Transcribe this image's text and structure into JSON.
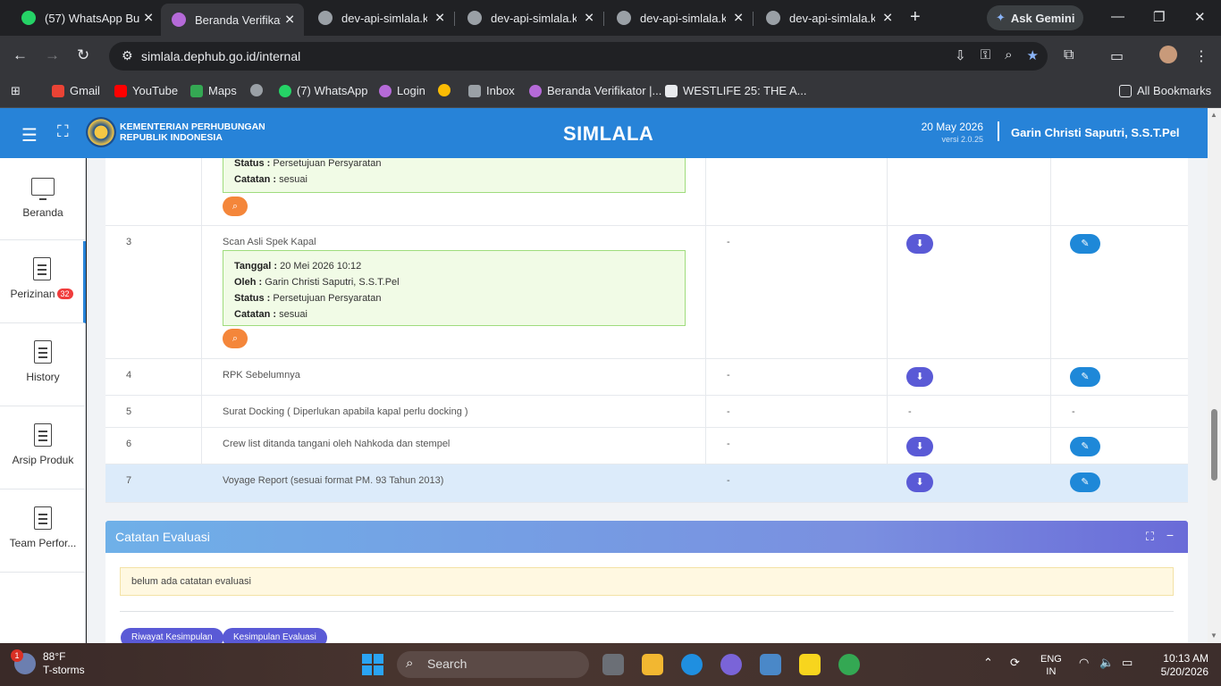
{
  "browser": {
    "tabs": [
      {
        "title": "(57) WhatsApp Bu",
        "favicon_color": "#25d366",
        "active": false
      },
      {
        "title": "Beranda Verifikato",
        "favicon_color": "#b56ad8",
        "active": true
      },
      {
        "title": "dev-api-simlala.ke",
        "favicon_color": "#9aa0a6",
        "active": false
      },
      {
        "title": "dev-api-simlala.ke",
        "favicon_color": "#9aa0a6",
        "active": false
      },
      {
        "title": "dev-api-simlala.ke",
        "favicon_color": "#9aa0a6",
        "active": false
      },
      {
        "title": "dev-api-simlala.ke",
        "favicon_color": "#9aa0a6",
        "active": false
      }
    ],
    "new_tab_symbol": "+",
    "ask_gemini": "Ask Gemini",
    "url": "simlala.dephub.go.id/internal",
    "bookmarks": [
      {
        "label": "Gmail",
        "color": "#ea4335"
      },
      {
        "label": "YouTube",
        "color": "#ff0000"
      },
      {
        "label": "Maps",
        "color": "#34a853"
      },
      {
        "label": "",
        "color": "#9aa0a6"
      },
      {
        "label": "(7) WhatsApp",
        "color": "#25d366"
      },
      {
        "label": "Login",
        "color": "#b56ad8"
      },
      {
        "label": "",
        "color": "#fbbc04"
      },
      {
        "label": "Inbox",
        "color": "#9aa0a6"
      },
      {
        "label": "Beranda Verifikator |...",
        "color": "#b56ad8"
      },
      {
        "label": "WESTLIFE 25: THE A...",
        "color": "#e8eaed"
      }
    ],
    "all_bookmarks": "All Bookmarks"
  },
  "header": {
    "ministry_line1": "KEMENTERIAN PERHUBUNGAN",
    "ministry_line2": "REPUBLIK INDONESIA",
    "title": "SIMLALA",
    "date": "20 May 2026",
    "version": "versi 2.0.25",
    "user": "Garin Christi Saputri, S.S.T.Pel"
  },
  "sidebar": {
    "items": [
      {
        "label": "Beranda"
      },
      {
        "label": "Perizinan",
        "badge": "32"
      },
      {
        "label": "History"
      },
      {
        "label": "Arsip Produk"
      },
      {
        "label": "Team Perfor..."
      }
    ]
  },
  "table": {
    "prev_row": {
      "status_label": "Status :",
      "status_value": "Persetujuan Persyaratan",
      "catatan_label": "Catatan :",
      "catatan_value": "sesuai"
    },
    "rows": [
      {
        "no": "3",
        "name": "Scan Asli Spek Kapal",
        "tanggal_label": "Tanggal :",
        "tanggal": "20 Mei 2026 10:12",
        "oleh_label": "Oleh :",
        "oleh": "Garin Christi Saputri, S.S.T.Pel",
        "status_label": "Status :",
        "status": "Persetujuan Persyaratan",
        "catatan_label": "Catatan :",
        "catatan": "sesuai",
        "col3": "-"
      },
      {
        "no": "4",
        "name": "RPK Sebelumnya",
        "col3": "-"
      },
      {
        "no": "5",
        "name": "Surat Docking ( Diperlukan apabila kapal perlu docking )",
        "col3": "-",
        "col4": "-",
        "col5": "-"
      },
      {
        "no": "6",
        "name": "Crew list ditanda tangani oleh Nahkoda dan stempel",
        "col3": "-"
      },
      {
        "no": "7",
        "name": "Voyage Report (sesuai format PM. 93 Tahun 2013)",
        "col3": "-"
      }
    ]
  },
  "evaluasi": {
    "title": "Catatan Evaluasi",
    "note": "belum ada catatan evaluasi",
    "btn_riwayat": "Riwayat Kesimpulan",
    "btn_kesimpulan": "Kesimpulan Evaluasi"
  },
  "taskbar": {
    "weather_badge": "1",
    "temperature": "88°F",
    "condition": "T-storms",
    "search_placeholder": "Search",
    "lang1": "ENG",
    "lang2": "IN",
    "time": "10:13 AM",
    "date": "5/20/2026"
  }
}
